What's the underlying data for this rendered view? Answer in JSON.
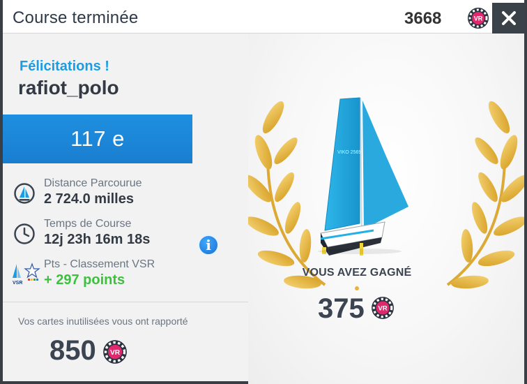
{
  "header": {
    "title": "Course terminée",
    "balance": "3668",
    "close_icon": "close-x-icon",
    "currency_icon": "vr-coin-icon"
  },
  "result": {
    "congrats": "Félicitations !",
    "username": "rafiot_polo",
    "rank": "117 e"
  },
  "stats": [
    {
      "icon": "sailboat-icon",
      "label": "Distance Parcourue",
      "value": "2 724.0 milles"
    },
    {
      "icon": "clock-icon",
      "label": "Temps de Course",
      "value": "12j 23h 16m 18s"
    },
    {
      "icon": "vsr-ranking-icon",
      "label": "Pts - Classement VSR",
      "value": "+ 297 points"
    }
  ],
  "vsr_logo": "VSR",
  "info_glyph": "i",
  "cards": {
    "text": "Vos cartes inutilisées vous ont rapporté",
    "value": "850"
  },
  "reward": {
    "label": "VOUS AVEZ GAGNÉ",
    "value": "375",
    "boat_sail_text": "VIKO 2569"
  },
  "coin_text": "VR",
  "colors": {
    "accent_blue": "#1a9de3",
    "rank_bar": "#1e88dd",
    "positive_green": "#3cc13c",
    "laurel_gold": "#e4b13a",
    "coin_pink": "#e0286d"
  }
}
